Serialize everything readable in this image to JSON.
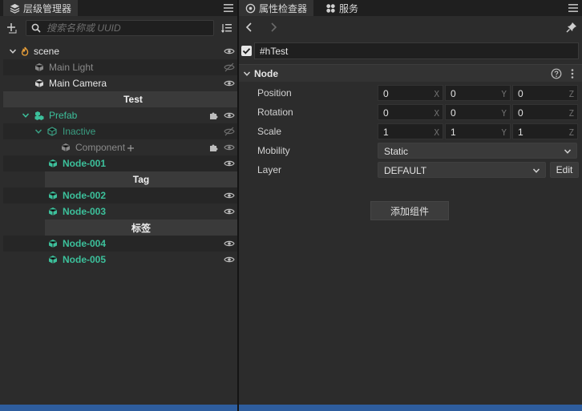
{
  "colors": {
    "accent": "#2e5d9e",
    "prefab_green": "#3cc09b",
    "background": "#2c2c2c"
  },
  "hierarchy_panel": {
    "tab_label": "层级管理器",
    "tab_icon": "layers-icon",
    "menu_icon": "hamburger-menu-icon",
    "search_placeholder": "搜索名称或 UUID",
    "tree": [
      {
        "label": "scene",
        "icon": "fire-icon",
        "expanded": true,
        "visible": true
      },
      {
        "label": "Main Light",
        "icon": "node-icon",
        "visible": false
      },
      {
        "label": "Main Camera",
        "icon": "node-icon",
        "visible": true
      },
      {
        "separator": "Test"
      },
      {
        "label": "Prefab",
        "icon": "prefab-icon",
        "expanded": true,
        "visible": true,
        "pinned": true
      },
      {
        "label": "Inactive",
        "icon": "node-icon",
        "expanded": true,
        "visible": false
      },
      {
        "label": "Component",
        "icon": "node-icon",
        "visible": true,
        "pinned": true
      },
      {
        "label": "Node-001",
        "icon": "node-icon",
        "visible": true
      },
      {
        "separator": "Tag"
      },
      {
        "label": "Node-002",
        "icon": "node-icon",
        "visible": true
      },
      {
        "label": "Node-003",
        "icon": "node-icon",
        "visible": true
      },
      {
        "separator": "标签"
      },
      {
        "label": "Node-004",
        "icon": "node-icon",
        "visible": true
      },
      {
        "label": "Node-005",
        "icon": "node-icon",
        "visible": true
      }
    ]
  },
  "inspector_panel": {
    "tab_label": "属性检查器",
    "tab2_label": "服务",
    "node_name": "#hTest",
    "node_active": true,
    "component_title": "Node",
    "properties": {
      "position": {
        "label": "Position",
        "x": "0",
        "y": "0",
        "z": "0"
      },
      "rotation": {
        "label": "Rotation",
        "x": "0",
        "y": "0",
        "z": "0"
      },
      "scale": {
        "label": "Scale",
        "x": "1",
        "y": "1",
        "z": "1"
      },
      "mobility": {
        "label": "Mobility",
        "value": "Static"
      },
      "layer": {
        "label": "Layer",
        "value": "DEFAULT",
        "edit_label": "Edit"
      }
    },
    "axis_labels": {
      "x": "X",
      "y": "Y",
      "z": "Z"
    },
    "add_component_label": "添加组件"
  }
}
